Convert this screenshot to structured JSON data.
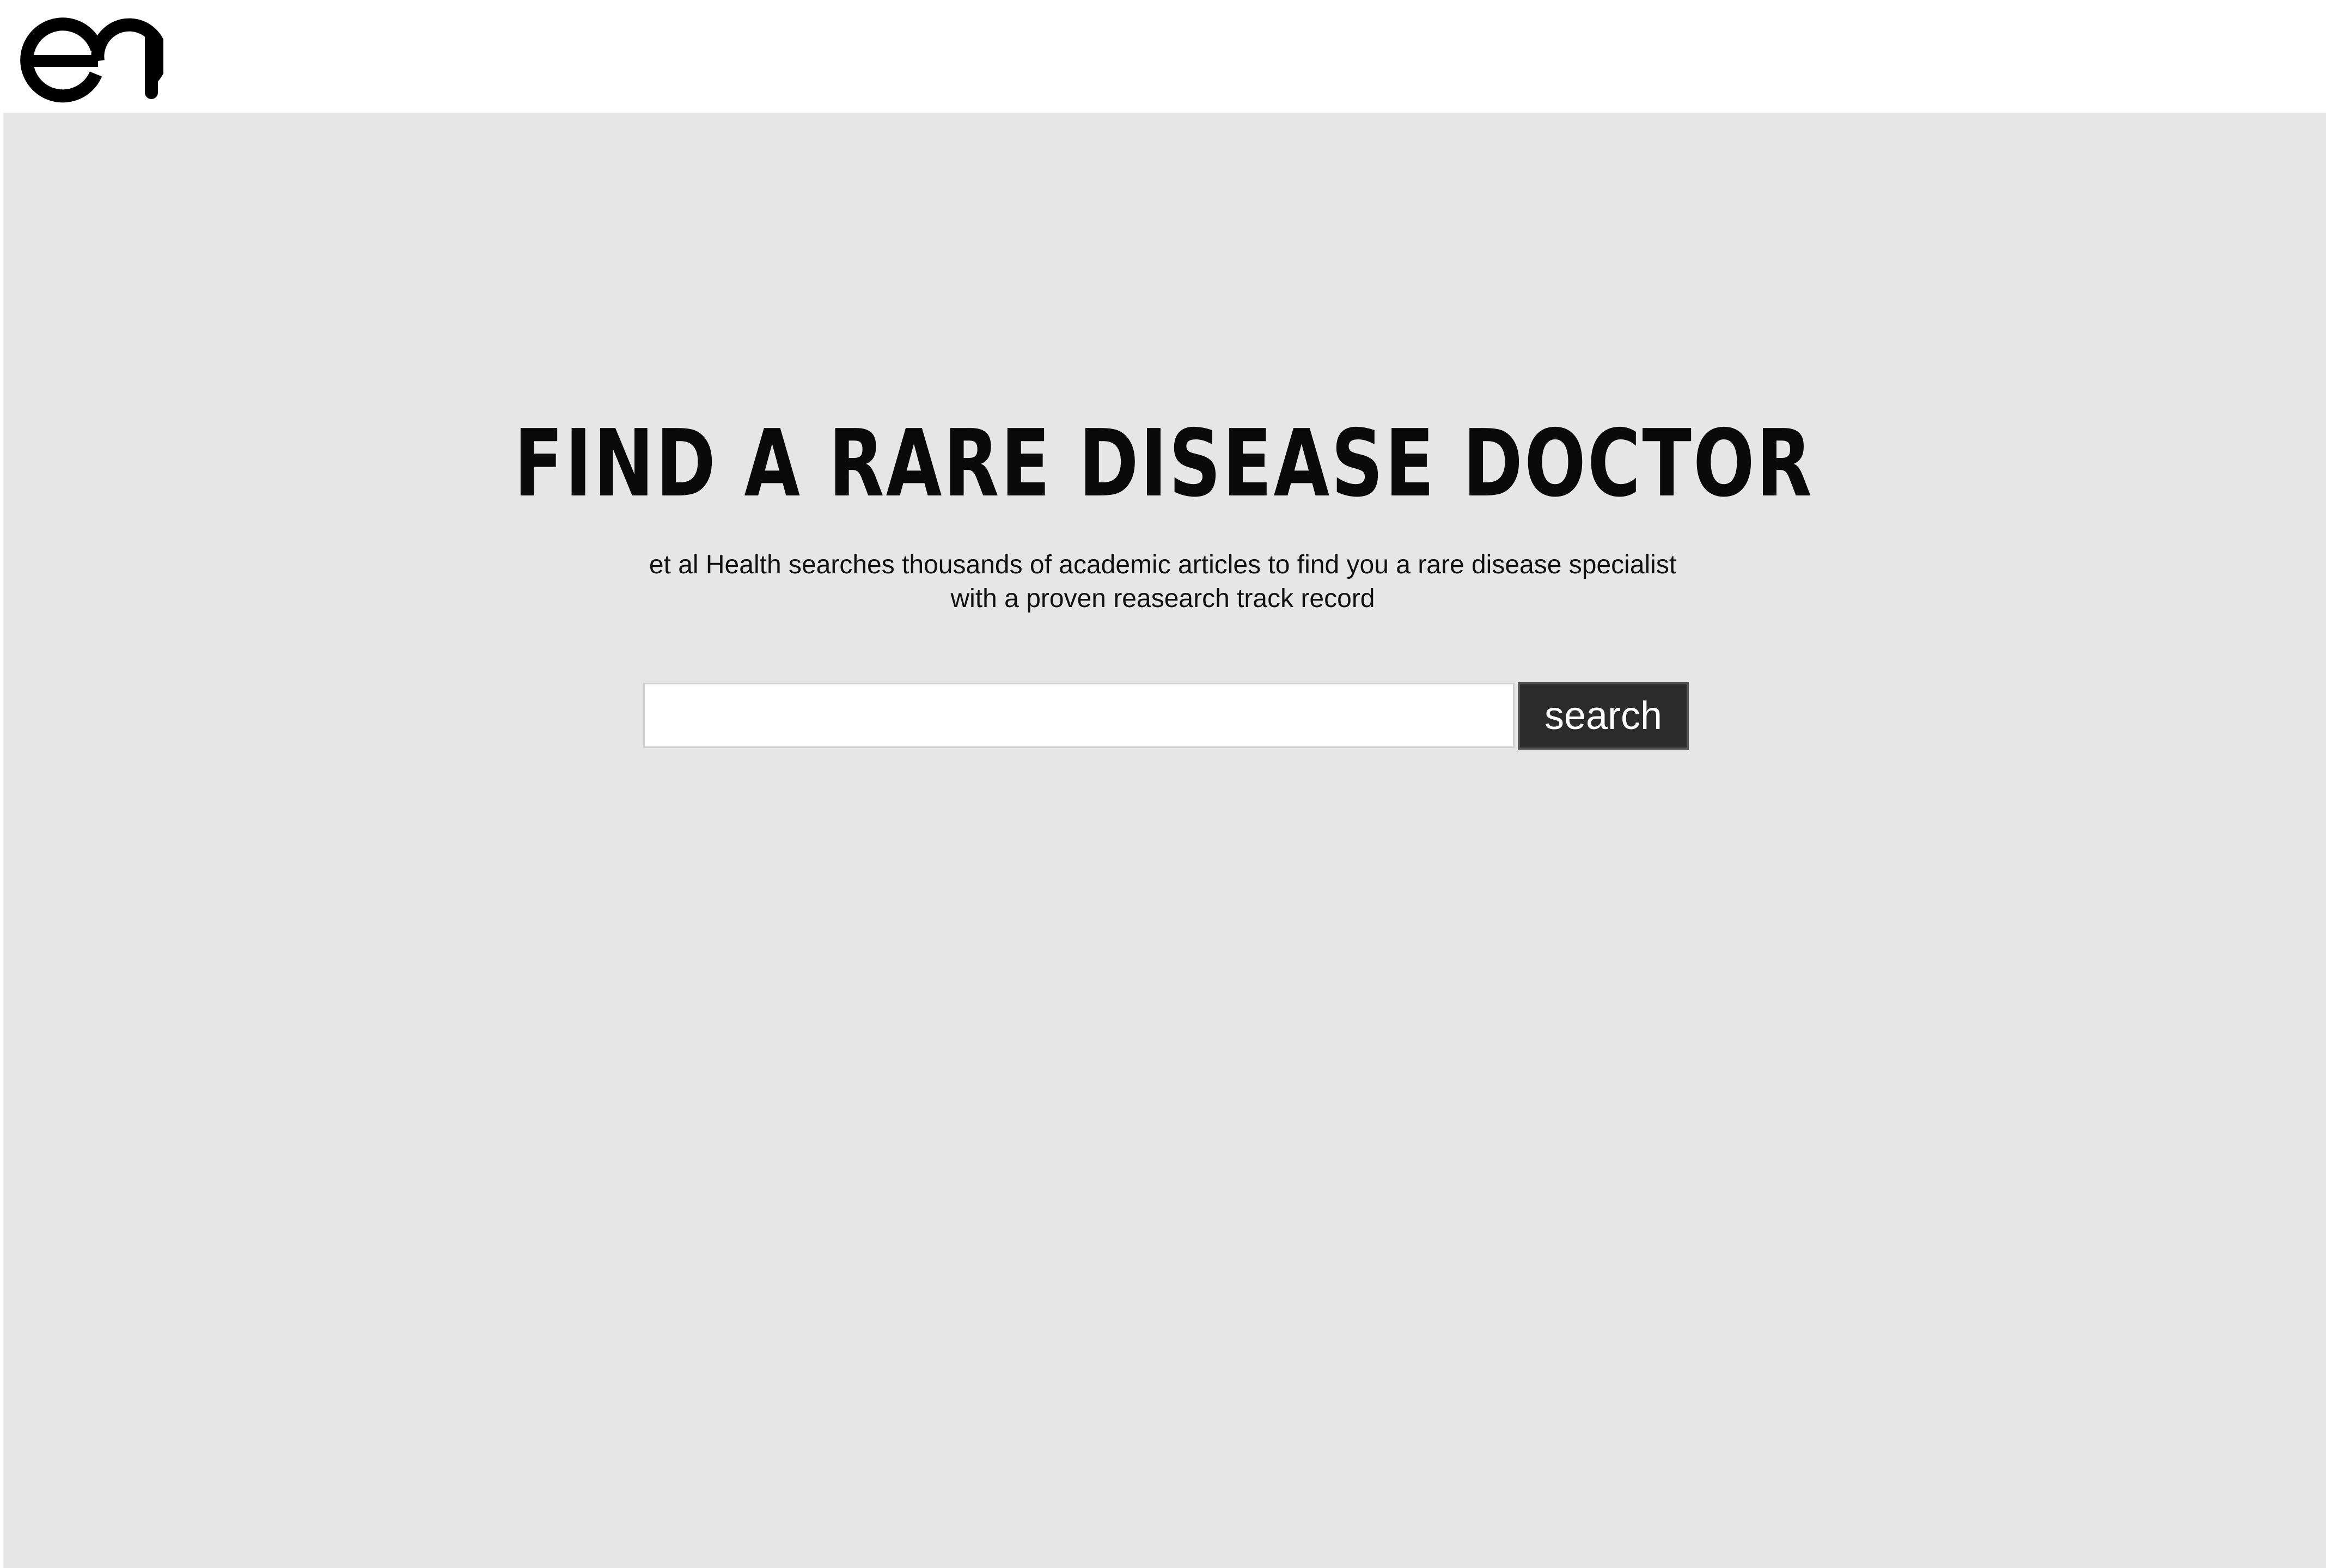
{
  "header": {
    "logo_icon": "ea-logo-icon",
    "logo_text": "ea"
  },
  "hero": {
    "title": "FIND A RARE DISEASE DOCTOR",
    "subtitle_line1": "et al Health searches thousands of academic articles to find you a rare disease specialist",
    "subtitle_line2": "with a proven reasearch track record"
  },
  "search": {
    "value": "",
    "placeholder": "",
    "button_label": "search"
  },
  "colors": {
    "background": "#e6e6e6",
    "header_background": "#ffffff",
    "button_background": "#2b2b2b",
    "text": "#0a0a0a"
  }
}
